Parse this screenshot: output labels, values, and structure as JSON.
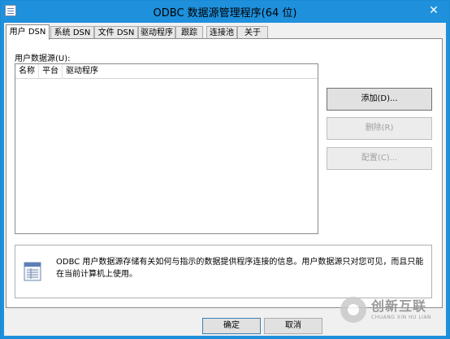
{
  "window": {
    "title": "ODBC 数据源管理程序(64 位)",
    "close_glyph": "✕"
  },
  "tabs": [
    {
      "label": "用户 DSN",
      "active": true
    },
    {
      "label": "系统 DSN",
      "active": false
    },
    {
      "label": "文件 DSN",
      "active": false
    },
    {
      "label": "驱动程序",
      "active": false
    },
    {
      "label": "跟踪",
      "active": false
    },
    {
      "label": "连接池",
      "active": false
    },
    {
      "label": "关于",
      "active": false
    }
  ],
  "panel": {
    "list_label": "用户数据源(U):",
    "columns": [
      "名称",
      "平台",
      "驱动程序"
    ],
    "rows": [],
    "buttons": {
      "add": "添加(D)...",
      "remove": "删除(R)",
      "configure": "配置(C)..."
    },
    "info_text": "ODBC 用户数据源存储有关如何与指示的数据提供程序连接的信息。用户数据源只对您可见，而且只能在当前计算机上使用。"
  },
  "footer": {
    "ok": "确定",
    "cancel": "取消"
  },
  "watermark": {
    "text": "创新互联",
    "sub": "CHUANG XIN HU LIAN"
  },
  "colors": {
    "titlebar": "#1e90dc",
    "client_bg": "#f0f0f0"
  }
}
